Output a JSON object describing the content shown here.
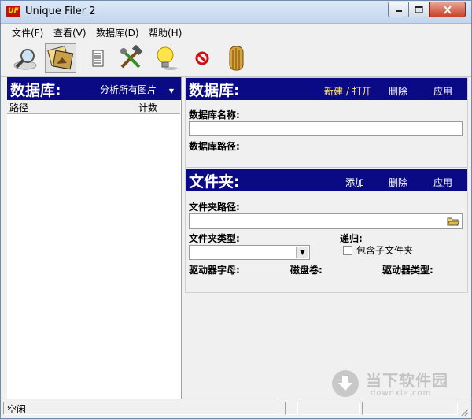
{
  "window": {
    "title": "Unique Filer 2",
    "app_icon_text": "UF"
  },
  "menu": [
    "文件(F)",
    "查看(V)",
    "数据库(D)",
    "帮助(H)"
  ],
  "toolbar": {
    "icons": [
      "magnifier-icon",
      "photos-icon",
      "document-icon",
      "tools-icon",
      "lightbulb-icon",
      "stop-icon",
      "door-icon"
    ]
  },
  "left": {
    "title": "数据库:",
    "dropdown_value": "分析所有图片",
    "col_path": "路径",
    "col_count": "计数"
  },
  "database": {
    "title": "数据库:",
    "new_open": "新建 / 打开",
    "delete": "删除",
    "apply": "应用",
    "name_label": "数据库名称:",
    "name_value": "",
    "path_label": "数据库路径:"
  },
  "folder": {
    "title": "文件夹:",
    "add": "添加",
    "delete": "删除",
    "apply": "应用",
    "path_label": "文件夹路径:",
    "path_value": "",
    "type_label": "文件夹类型:",
    "type_value": "",
    "recursive_label": "递归:",
    "include_sub": "包含子文件夹",
    "drive_letter": "驱动器字母:",
    "volume": "磁盘卷:",
    "drive_type": "驱动器类型:"
  },
  "status": {
    "text": "空闲"
  },
  "watermark": {
    "text": "当下软件园",
    "url": "downxia.com"
  }
}
